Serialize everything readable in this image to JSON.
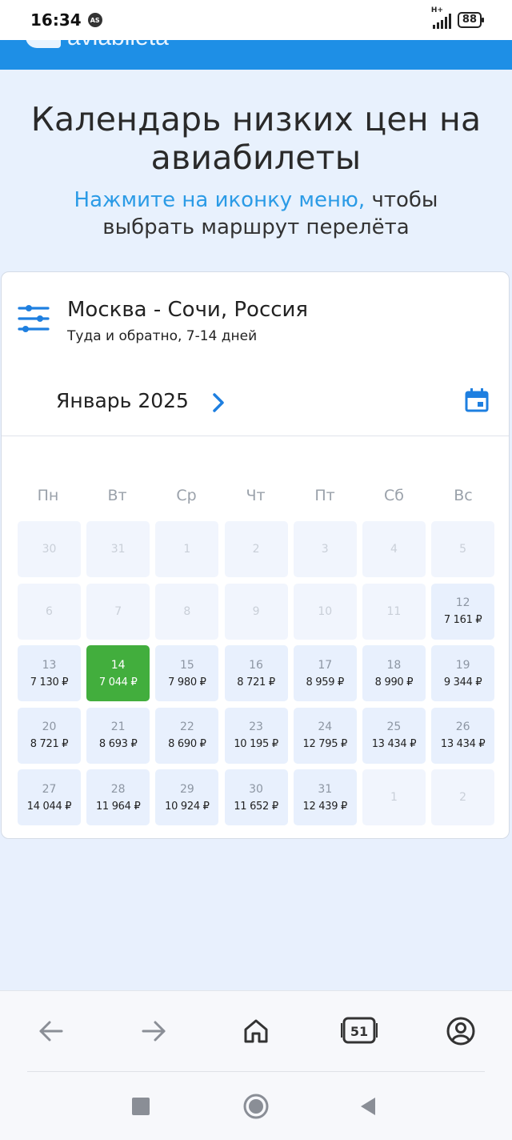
{
  "status": {
    "time": "16:34",
    "badge": "AS",
    "network": "H+",
    "battery": "88"
  },
  "site": {
    "logo_text": "aviabileta",
    "brand_color": "#1e8fe6"
  },
  "hero": {
    "title": "Календарь низких цен на авиабилеты",
    "link_text": "Нажмите на иконку меню,",
    "rest_text": " чтобы выбрать маршрут перелёта"
  },
  "route": {
    "title": "Москва - Сочи, Россия",
    "subtitle": "Туда и обратно, 7-14 дней",
    "filter_icon": "sliders-icon"
  },
  "calendar": {
    "month_label": "Январь 2025",
    "next_icon": "chevron-right-icon",
    "calendar_icon": "calendar-icon",
    "weekdays": [
      "Пн",
      "Вт",
      "Ср",
      "Чт",
      "Пт",
      "Сб",
      "Вс"
    ],
    "weeks": [
      [
        {
          "day": "30",
          "price": "",
          "state": "inactive"
        },
        {
          "day": "31",
          "price": "",
          "state": "inactive"
        },
        {
          "day": "1",
          "price": "",
          "state": "inactive"
        },
        {
          "day": "2",
          "price": "",
          "state": "inactive"
        },
        {
          "day": "3",
          "price": "",
          "state": "inactive"
        },
        {
          "day": "4",
          "price": "",
          "state": "inactive"
        },
        {
          "day": "5",
          "price": "",
          "state": "inactive"
        }
      ],
      [
        {
          "day": "6",
          "price": "",
          "state": "inactive"
        },
        {
          "day": "7",
          "price": "",
          "state": "inactive"
        },
        {
          "day": "8",
          "price": "",
          "state": "inactive"
        },
        {
          "day": "9",
          "price": "",
          "state": "inactive"
        },
        {
          "day": "10",
          "price": "",
          "state": "inactive"
        },
        {
          "day": "11",
          "price": "",
          "state": "inactive"
        },
        {
          "day": "12",
          "price": "7 161 ₽",
          "state": "normal"
        }
      ],
      [
        {
          "day": "13",
          "price": "7 130 ₽",
          "state": "normal"
        },
        {
          "day": "14",
          "price": "7 044 ₽",
          "state": "active"
        },
        {
          "day": "15",
          "price": "7 980 ₽",
          "state": "normal"
        },
        {
          "day": "16",
          "price": "8 721 ₽",
          "state": "normal"
        },
        {
          "day": "17",
          "price": "8 959 ₽",
          "state": "normal"
        },
        {
          "day": "18",
          "price": "8 990 ₽",
          "state": "normal"
        },
        {
          "day": "19",
          "price": "9 344 ₽",
          "state": "normal"
        }
      ],
      [
        {
          "day": "20",
          "price": "8 721 ₽",
          "state": "normal"
        },
        {
          "day": "21",
          "price": "8 693 ₽",
          "state": "normal"
        },
        {
          "day": "22",
          "price": "8 690 ₽",
          "state": "normal"
        },
        {
          "day": "23",
          "price": "10 195 ₽",
          "state": "normal"
        },
        {
          "day": "24",
          "price": "12 795 ₽",
          "state": "normal"
        },
        {
          "day": "25",
          "price": "13 434 ₽",
          "state": "normal"
        },
        {
          "day": "26",
          "price": "13 434 ₽",
          "state": "normal"
        }
      ],
      [
        {
          "day": "27",
          "price": "14 044 ₽",
          "state": "normal"
        },
        {
          "day": "28",
          "price": "11 964 ₽",
          "state": "normal"
        },
        {
          "day": "29",
          "price": "10 924 ₽",
          "state": "normal"
        },
        {
          "day": "30",
          "price": "11 652 ₽",
          "state": "normal"
        },
        {
          "day": "31",
          "price": "12 439 ₽",
          "state": "normal"
        },
        {
          "day": "1",
          "price": "",
          "state": "inactive"
        },
        {
          "day": "2",
          "price": "",
          "state": "inactive"
        }
      ]
    ],
    "colors": {
      "cell": "#e8f0fd",
      "inactive_cell": "#f1f5fd",
      "selected_cell": "#42ae3d",
      "accent": "#1e7fe0"
    }
  },
  "browser_nav": {
    "back_icon": "arrow-left-icon",
    "forward_icon": "arrow-right-icon",
    "home_icon": "home-icon",
    "tabs_icon": "tabs-icon",
    "tabs_count": "51",
    "account_icon": "account-icon"
  },
  "system_nav": {
    "recents_icon": "square-icon",
    "home_icon": "circle-icon",
    "back_icon": "triangle-back-icon"
  }
}
